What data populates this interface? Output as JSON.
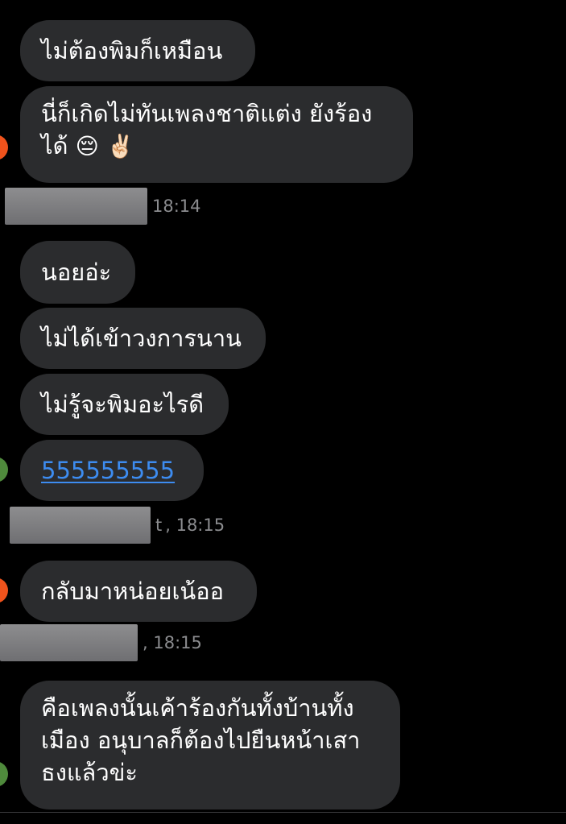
{
  "colors": {
    "background": "#000000",
    "bubble": "#2b2c2e",
    "text": "#ffffff",
    "meta_text": "#8b8c8f",
    "link": "#3d8cf0",
    "avatar_orange": "#f0531c",
    "avatar_green": "#4f8a3c"
  },
  "messages": [
    {
      "text": "ไม่ต้องพิมก็เหมือน"
    },
    {
      "lines": [
        "นี่ก็เกิดไม่ทันเพลงชาติแต่ง ยังร้อง",
        "ได้"
      ],
      "emojis": [
        "😔",
        "✌🏻"
      ],
      "avatar_icon": "avatar-orange-icon"
    },
    {
      "text": "นอยอ่ะ"
    },
    {
      "text": "ไม่ได้เข้าวงการนาน"
    },
    {
      "text": "ไม่รู้จะพิมอะไรดี"
    },
    {
      "text": "555555555",
      "is_link": true,
      "avatar_icon": "avatar-green-icon"
    },
    {
      "text": "กลับมาหน่อยเน้ออ",
      "avatar_icon": "avatar-orange-icon"
    },
    {
      "lines": [
        "คือเพลงนั้นเค้าร้องกันทั้งบ้านทั้ง",
        "เมือง อนุบาลก็ต้องไปยืนหน้าเสา",
        "ธงแล้วข่ะ"
      ],
      "avatar_icon": "avatar-green-icon"
    }
  ],
  "meta": [
    {
      "time": "18:14"
    },
    {
      "name_tail": "t",
      "time": ", 18:15"
    },
    {
      "time": ", 18:15"
    }
  ]
}
